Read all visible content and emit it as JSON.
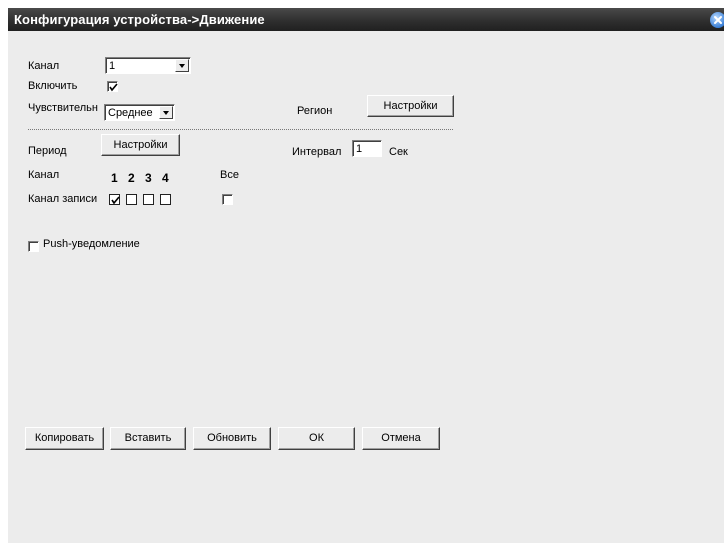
{
  "window": {
    "title": "Конфигурация устройства->Движение"
  },
  "channel": {
    "label": "Канал",
    "value": "1"
  },
  "enable": {
    "label": "Включить",
    "checked": true
  },
  "sensitivity": {
    "label": "Чувствительн",
    "value": "Среднее"
  },
  "region": {
    "label": "Регион",
    "button": "Настройки"
  },
  "period": {
    "label": "Период",
    "button": "Настройки"
  },
  "interval": {
    "label": "Интервал",
    "value": "1",
    "unit": "Сек"
  },
  "channels_row": {
    "label": "Канал",
    "numbers": [
      "1",
      "2",
      "3",
      "4"
    ],
    "all_label": "Все"
  },
  "record_channel": {
    "label": "Канал записи",
    "checked": [
      true,
      false,
      false,
      false
    ],
    "all_checked": false
  },
  "push": {
    "label": "Push-уведомление",
    "checked": false
  },
  "buttons": {
    "copy": "Копировать",
    "paste": "Вставить",
    "refresh": "Обновить",
    "ok": "ОК",
    "cancel": "Отмена"
  }
}
